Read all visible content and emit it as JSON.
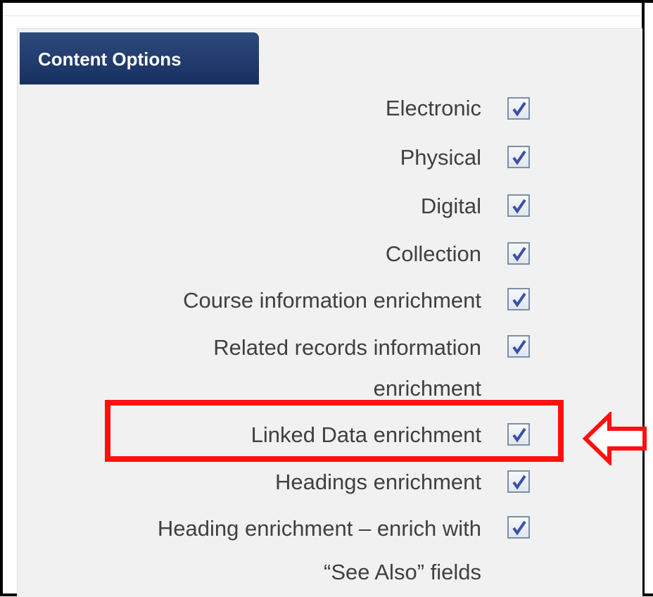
{
  "tab": {
    "label": "Content Options"
  },
  "options": [
    {
      "label": "Electronic",
      "checked": true
    },
    {
      "label": "Physical",
      "checked": true
    },
    {
      "label": "Digital",
      "checked": true
    },
    {
      "label": "Collection",
      "checked": true
    },
    {
      "label": "Course information enrichment",
      "checked": true
    },
    {
      "label_line1": "Related records information",
      "label_line2": "enrichment",
      "checked": true
    },
    {
      "label": "Linked Data enrichment",
      "checked": true
    },
    {
      "label": "Headings enrichment",
      "checked": true
    },
    {
      "label_line1": "Heading enrichment – enrich with",
      "label_line2": "“See Also” fields",
      "checked": true
    }
  ],
  "colors": {
    "tab_background": "#173061",
    "highlight": "#ff1010",
    "label_text": "#404040"
  }
}
